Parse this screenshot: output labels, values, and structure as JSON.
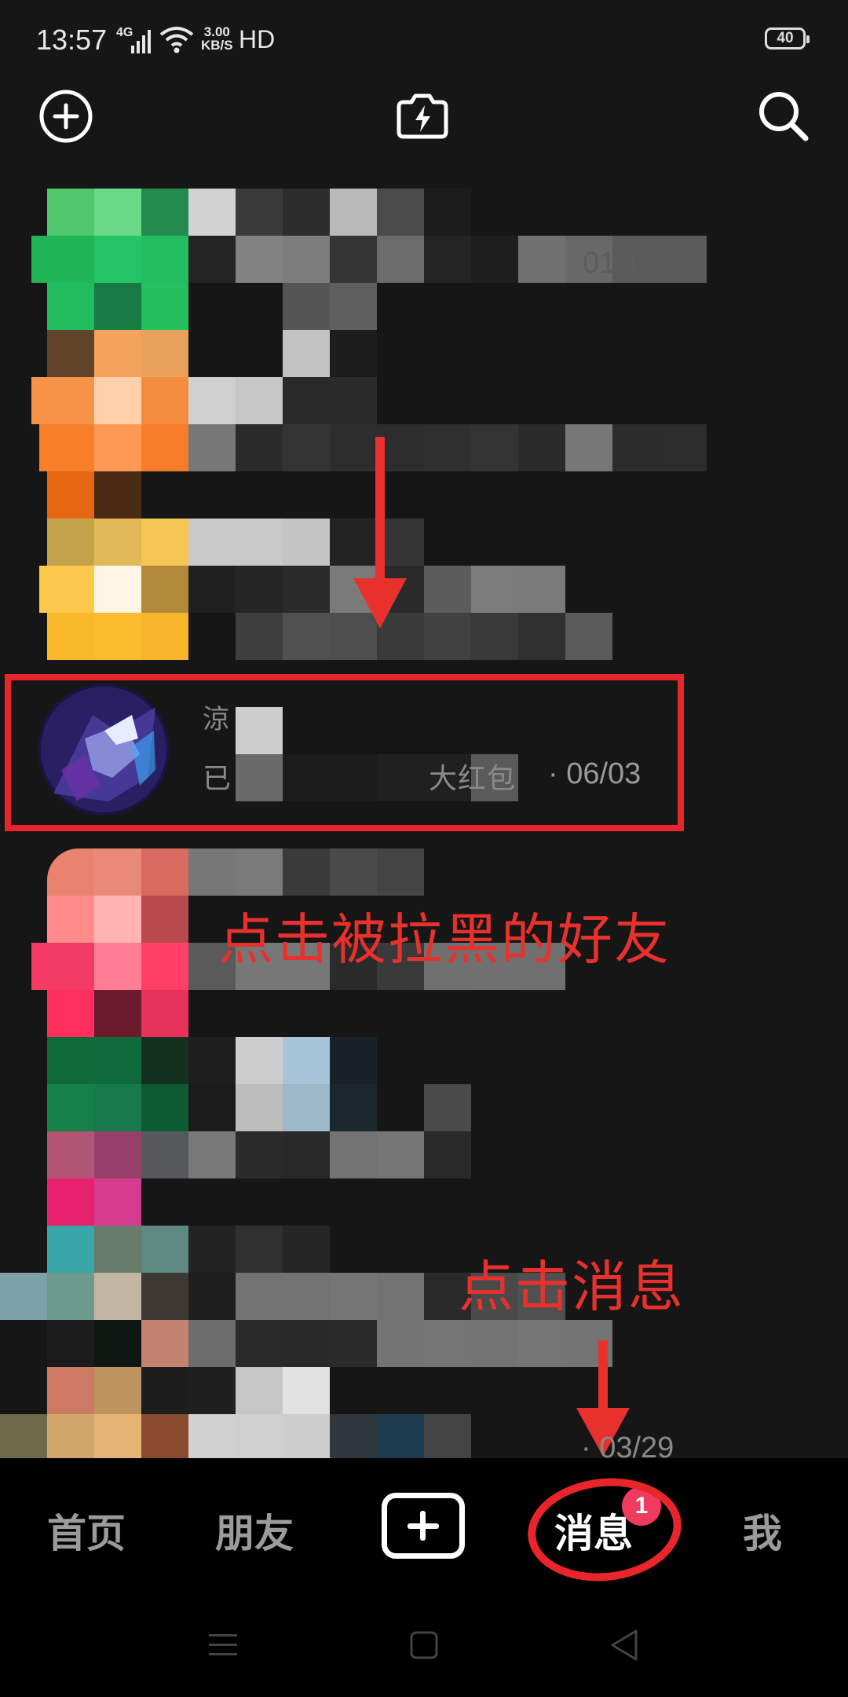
{
  "status_bar": {
    "time": "13:57",
    "network": "4G",
    "speed_value": "3.00",
    "speed_unit": "KB/S",
    "hd": "HD",
    "battery": "40"
  },
  "header": {
    "add_icon": "plus-circle-icon",
    "flash_icon": "flash-camera-icon",
    "search_icon": "search-icon"
  },
  "highlighted_row": {
    "name_visible": "涼",
    "subtitle_start": "已",
    "subtitle_end": "大红包",
    "time": "· 06/03"
  },
  "annotations": {
    "tap_blocked_friend": "点击被拉黑的好友",
    "tap_messages": "点击消息"
  },
  "list_date_bottom": "· 03/29",
  "partial_time_top": "01:13",
  "bottom_nav": {
    "home": "首页",
    "friends": "朋友",
    "messages": "消息",
    "messages_badge": "1",
    "me": "我"
  },
  "colors": {
    "accent_red": "#e8252b",
    "badge": "#f03a5f",
    "background": "#161616"
  }
}
